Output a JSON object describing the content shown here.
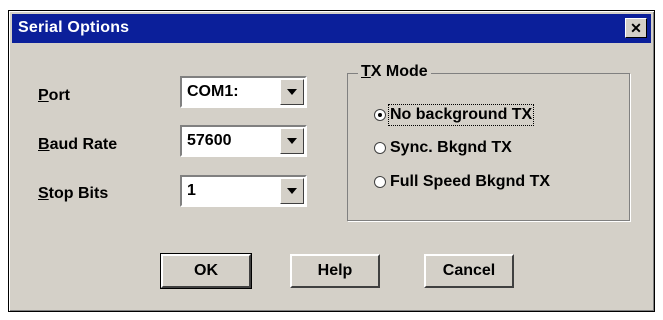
{
  "dialog": {
    "title": "Serial Options",
    "close_glyph": "✕"
  },
  "fields": {
    "port": {
      "mnemonic": "P",
      "rest": "ort",
      "value": "COM1:"
    },
    "baud": {
      "mnemonic": "B",
      "rest": "aud Rate",
      "value": "57600"
    },
    "stop": {
      "mnemonic": "S",
      "rest": "top Bits",
      "value": "1"
    }
  },
  "tx_mode": {
    "title_mnemonic": "T",
    "title_rest": "X Mode",
    "options": [
      {
        "label": "No background TX",
        "selected": true
      },
      {
        "label": "Sync. Bkgnd TX",
        "selected": false
      },
      {
        "label": "Full Speed Bkgnd TX",
        "selected": false
      }
    ]
  },
  "buttons": {
    "ok": "OK",
    "help": "Help",
    "cancel": "Cancel"
  },
  "colors": {
    "titlebar": "#0b1f9a",
    "face": "#d4d0c8"
  },
  "icons": [
    "close-icon",
    "dropdown-arrow-icon",
    "radio-dot-icon"
  ]
}
